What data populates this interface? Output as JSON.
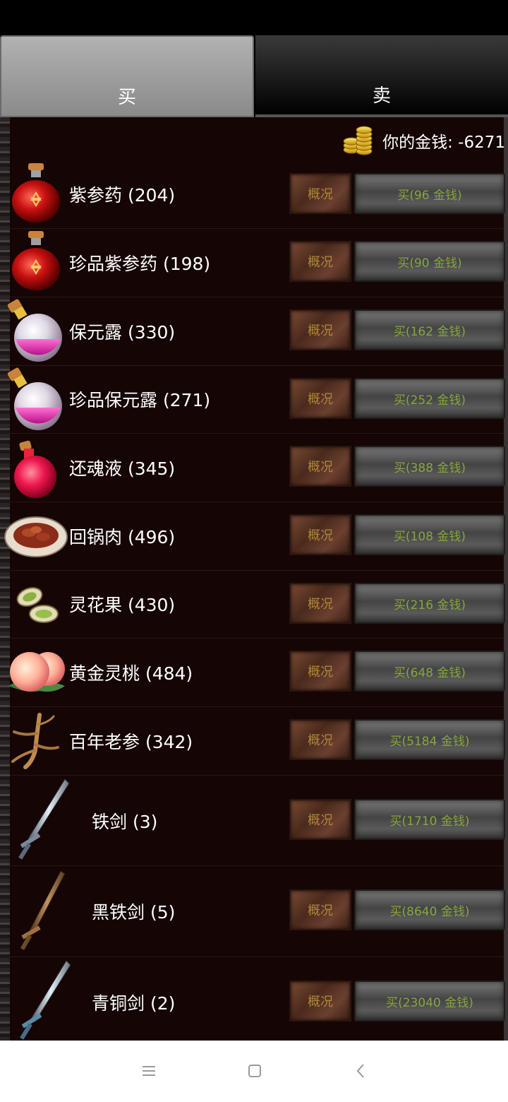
{
  "tabs": {
    "buy": "买",
    "sell": "卖"
  },
  "money": {
    "label": "你的金钱: -6271"
  },
  "items": [
    {
      "name": "紫参药 (204)",
      "info": "概况",
      "buy": "买(96 金钱)",
      "icon": "red-potion-icon"
    },
    {
      "name": "珍品紫参药 (198)",
      "info": "概况",
      "buy": "买(90 金钱)",
      "icon": "red-potion-icon"
    },
    {
      "name": "保元露 (330)",
      "info": "概况",
      "buy": "买(162 金钱)",
      "icon": "pink-potion-icon"
    },
    {
      "name": "珍品保元露 (271)",
      "info": "概况",
      "buy": "买(252 金钱)",
      "icon": "pink-potion-icon"
    },
    {
      "name": "还魂液 (345)",
      "info": "概况",
      "buy": "买(388 金钱)",
      "icon": "crimson-potion-icon"
    },
    {
      "name": "回锅肉 (496)",
      "info": "概况",
      "buy": "买(108 金钱)",
      "icon": "meat-dish-icon"
    },
    {
      "name": "灵花果 (430)",
      "info": "概况",
      "buy": "买(216 金钱)",
      "icon": "nut-icon"
    },
    {
      "name": "黄金灵桃 (484)",
      "info": "概况",
      "buy": "买(648 金钱)",
      "icon": "peach-icon"
    },
    {
      "name": "百年老参 (342)",
      "info": "概况",
      "buy": "买(5184 金钱)",
      "icon": "ginseng-icon"
    },
    {
      "name": "铁剑 (3)",
      "info": "概况",
      "buy": "买(1710 金钱)",
      "icon": "iron-sword-icon"
    },
    {
      "name": "黑铁剑 (5)",
      "info": "概况",
      "buy": "买(8640 金钱)",
      "icon": "black-iron-sword-icon"
    },
    {
      "name": "青铜剑 (2)",
      "info": "概况",
      "buy": "买(23040 金钱)",
      "icon": "bronze-sword-icon"
    }
  ]
}
